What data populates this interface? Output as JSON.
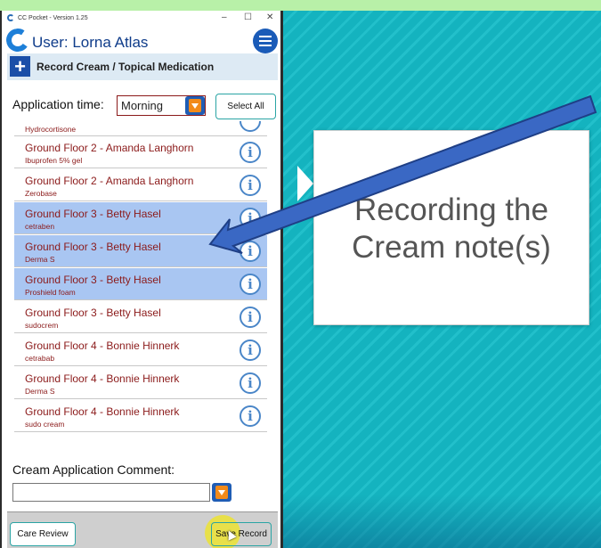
{
  "window": {
    "title": "CC Pocket - Version 1.25",
    "min_label": "–",
    "max_label": "☐",
    "close_label": "✕"
  },
  "header": {
    "user_label": "User: Lorna Atlas"
  },
  "section": {
    "title": "Record Cream / Topical Medication",
    "icon": "plus-icon"
  },
  "application_time": {
    "label": "Application time:",
    "value": "Morning"
  },
  "select_all_label": "Select All",
  "list": {
    "first_partial": {
      "medication": "Hydrocortisone"
    },
    "rows": [
      {
        "location": "Ground Floor 2 - Amanda Langhorn",
        "medication": "Ibuprofen 5%  gel",
        "selected": false
      },
      {
        "location": "Ground Floor 2 - Amanda Langhorn",
        "medication": "Zerobase",
        "selected": false
      },
      {
        "location": "Ground Floor 3 - Betty Hasel",
        "medication": "cetraben",
        "selected": true
      },
      {
        "location": "Ground Floor 3 - Betty Hasel",
        "medication": "Derma S",
        "selected": true
      },
      {
        "location": "Ground Floor 3 - Betty Hasel",
        "medication": "Proshield foam",
        "selected": true
      },
      {
        "location": "Ground Floor 3 - Betty Hasel",
        "medication": "sudocrem",
        "selected": false
      },
      {
        "location": "Ground Floor 4 - Bonnie Hinnerk",
        "medication": "cetrabab",
        "selected": false
      },
      {
        "location": "Ground Floor 4 - Bonnie Hinnerk",
        "medication": "Derma S",
        "selected": false
      },
      {
        "location": "Ground Floor 4 - Bonnie Hinnerk",
        "medication": "sudo cream",
        "selected": false
      }
    ]
  },
  "comment": {
    "label": "Cream Application Comment:",
    "value": ""
  },
  "footer": {
    "care_review_label": "Care Review",
    "save_record_label": "Save Record"
  },
  "callout": {
    "text": "Recording the\nCream note(s)"
  },
  "colors": {
    "accent_blue": "#1a5bb8",
    "selected_row": "#a9c6f2",
    "item_text": "#8b1a1a",
    "teal_bg": "#14b3bf",
    "arrow": "#3a68c4"
  }
}
